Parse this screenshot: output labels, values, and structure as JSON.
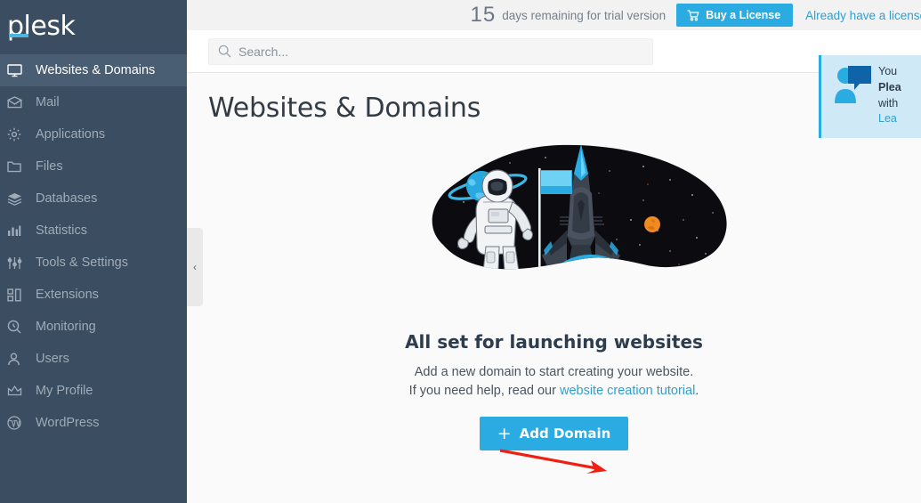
{
  "sidebar": {
    "logo": "plesk",
    "items": [
      {
        "label": "Websites & Domains",
        "icon": "monitor-icon",
        "active": true
      },
      {
        "label": "Mail",
        "icon": "envelope-icon",
        "active": false
      },
      {
        "label": "Applications",
        "icon": "gear-icon",
        "active": false
      },
      {
        "label": "Files",
        "icon": "folder-icon",
        "active": false
      },
      {
        "label": "Databases",
        "icon": "database-stack-icon",
        "active": false
      },
      {
        "label": "Statistics",
        "icon": "bar-chart-icon",
        "active": false
      },
      {
        "label": "Tools & Settings",
        "icon": "sliders-icon",
        "active": false
      },
      {
        "label": "Extensions",
        "icon": "blocks-icon",
        "active": false
      },
      {
        "label": "Monitoring",
        "icon": "magnifier-gauge-icon",
        "active": false
      },
      {
        "label": "Users",
        "icon": "person-icon",
        "active": false
      },
      {
        "label": "My Profile",
        "icon": "crown-icon",
        "active": false
      },
      {
        "label": "WordPress",
        "icon": "wordpress-icon",
        "active": false
      }
    ],
    "collapse_glyph": "‹"
  },
  "trialbar": {
    "days": "15",
    "days_text": "days remaining for trial version",
    "buy_label": "Buy a License",
    "have_license_label": "Already have a license"
  },
  "search": {
    "placeholder": "Search...",
    "value": ""
  },
  "main": {
    "page_title": "Websites & Domains",
    "empty_heading": "All set for launching websites",
    "empty_line1": "Add a new domain to start creating your website.",
    "empty_line2_prefix": "If you need help, read our ",
    "empty_link": "website creation tutorial",
    "empty_line2_suffix": ".",
    "add_domain_label": "Add Domain",
    "add_domain_plus": "+"
  },
  "notification": {
    "line1": "You",
    "line2": "Plea",
    "line3": "with",
    "link": "Lea"
  },
  "colors": {
    "sidebar_bg": "#3a4d61",
    "sidebar_active_bg": "#4a5e73",
    "accent_blue": "#2aace2",
    "link_blue": "#2f9fd0",
    "page_bg": "#fafafa",
    "trial_bar_bg": "#f2f2f2",
    "annotation_red": "#f01e13",
    "notif_bg": "#cfe9f7"
  }
}
